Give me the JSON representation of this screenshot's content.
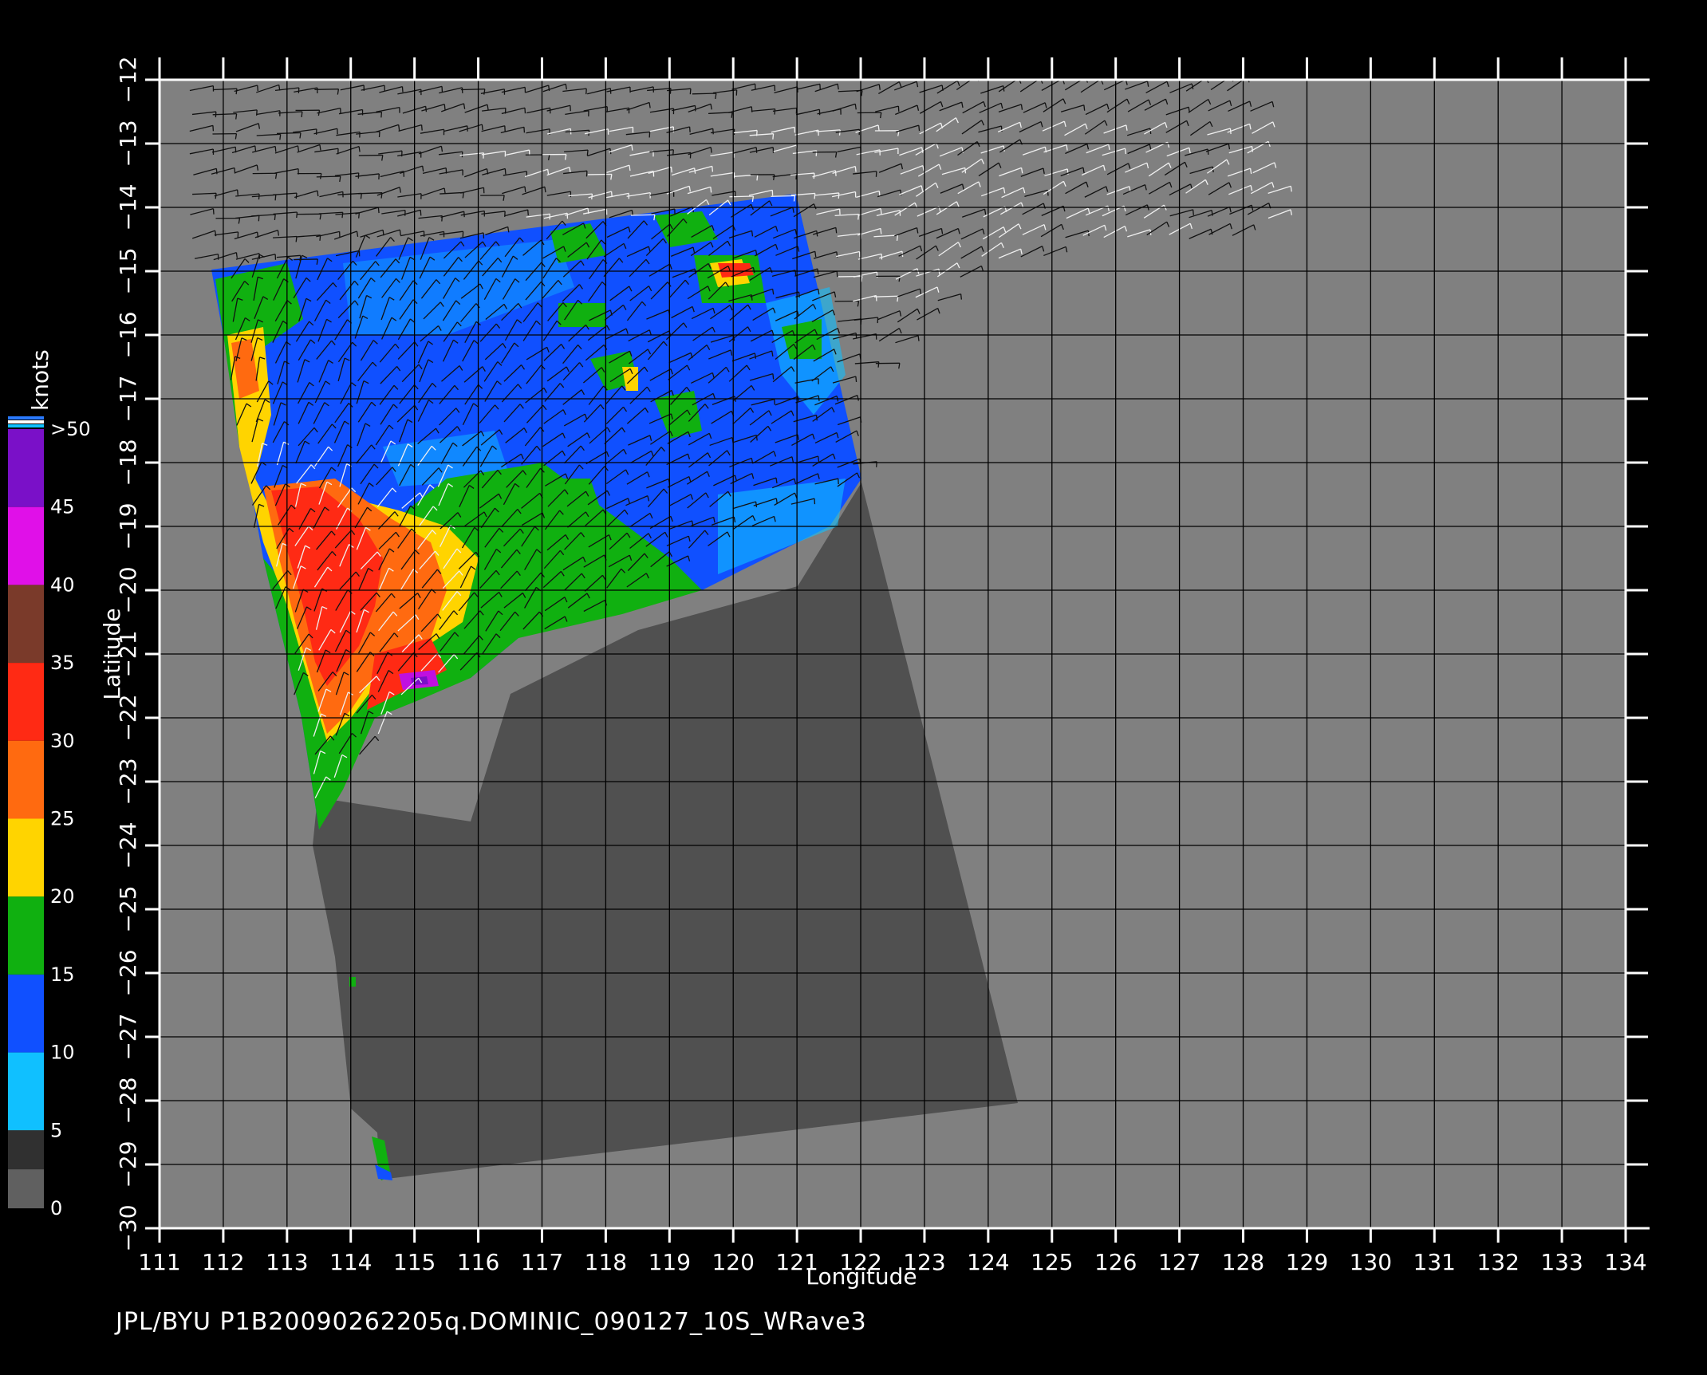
{
  "footer": {
    "label": "JPL/BYU  P1B20090262205q.DOMINIC_090127_10S_WRave3"
  },
  "axes": {
    "x_label": "Longitude",
    "y_label": "Latitude",
    "lon_range": [
      111,
      134
    ],
    "lat_range": [
      -30,
      -12
    ],
    "lon_ticks": [
      "111",
      "112",
      "113",
      "114",
      "115",
      "116",
      "117",
      "118",
      "119",
      "120",
      "121",
      "122",
      "123",
      "124",
      "125",
      "126",
      "127",
      "128",
      "129",
      "130",
      "131",
      "132",
      "133",
      "134"
    ],
    "lat_ticks": [
      "−12",
      "−13",
      "−14",
      "−15",
      "−16",
      "−17",
      "−18",
      "−19",
      "−20",
      "−21",
      "−22",
      "−23",
      "−24",
      "−25",
      "−26",
      "−27",
      "−28",
      "−29",
      "−30"
    ],
    "grid": true
  },
  "colorbar": {
    "title": "knots",
    "tick_labels": [
      ">50",
      "45",
      "40",
      "35",
      "30",
      "25",
      "20",
      "15",
      "10",
      "5",
      "0"
    ],
    "bands": [
      {
        "from": 45,
        "to": 50,
        "color": "#7a10c8"
      },
      {
        "from": 40,
        "to": 45,
        "color": "#e010e8"
      },
      {
        "from": 35,
        "to": 40,
        "color": "#7a3a2a"
      },
      {
        "from": 30,
        "to": 35,
        "color": "#ff2a14"
      },
      {
        "from": 25,
        "to": 30,
        "color": "#ff6a10"
      },
      {
        "from": 20,
        "to": 25,
        "color": "#ffd400"
      },
      {
        "from": 15,
        "to": 20,
        "color": "#10b010"
      },
      {
        "from": 10,
        "to": 15,
        "color": "#1050ff"
      },
      {
        "from": 5,
        "to": 10,
        "color": "#10c0ff"
      },
      {
        "from": 0,
        "to": 5,
        "color": "#404040"
      }
    ]
  },
  "map": {
    "background_color": "#808080",
    "land_color": "#505050",
    "legend_placement": "left"
  }
}
